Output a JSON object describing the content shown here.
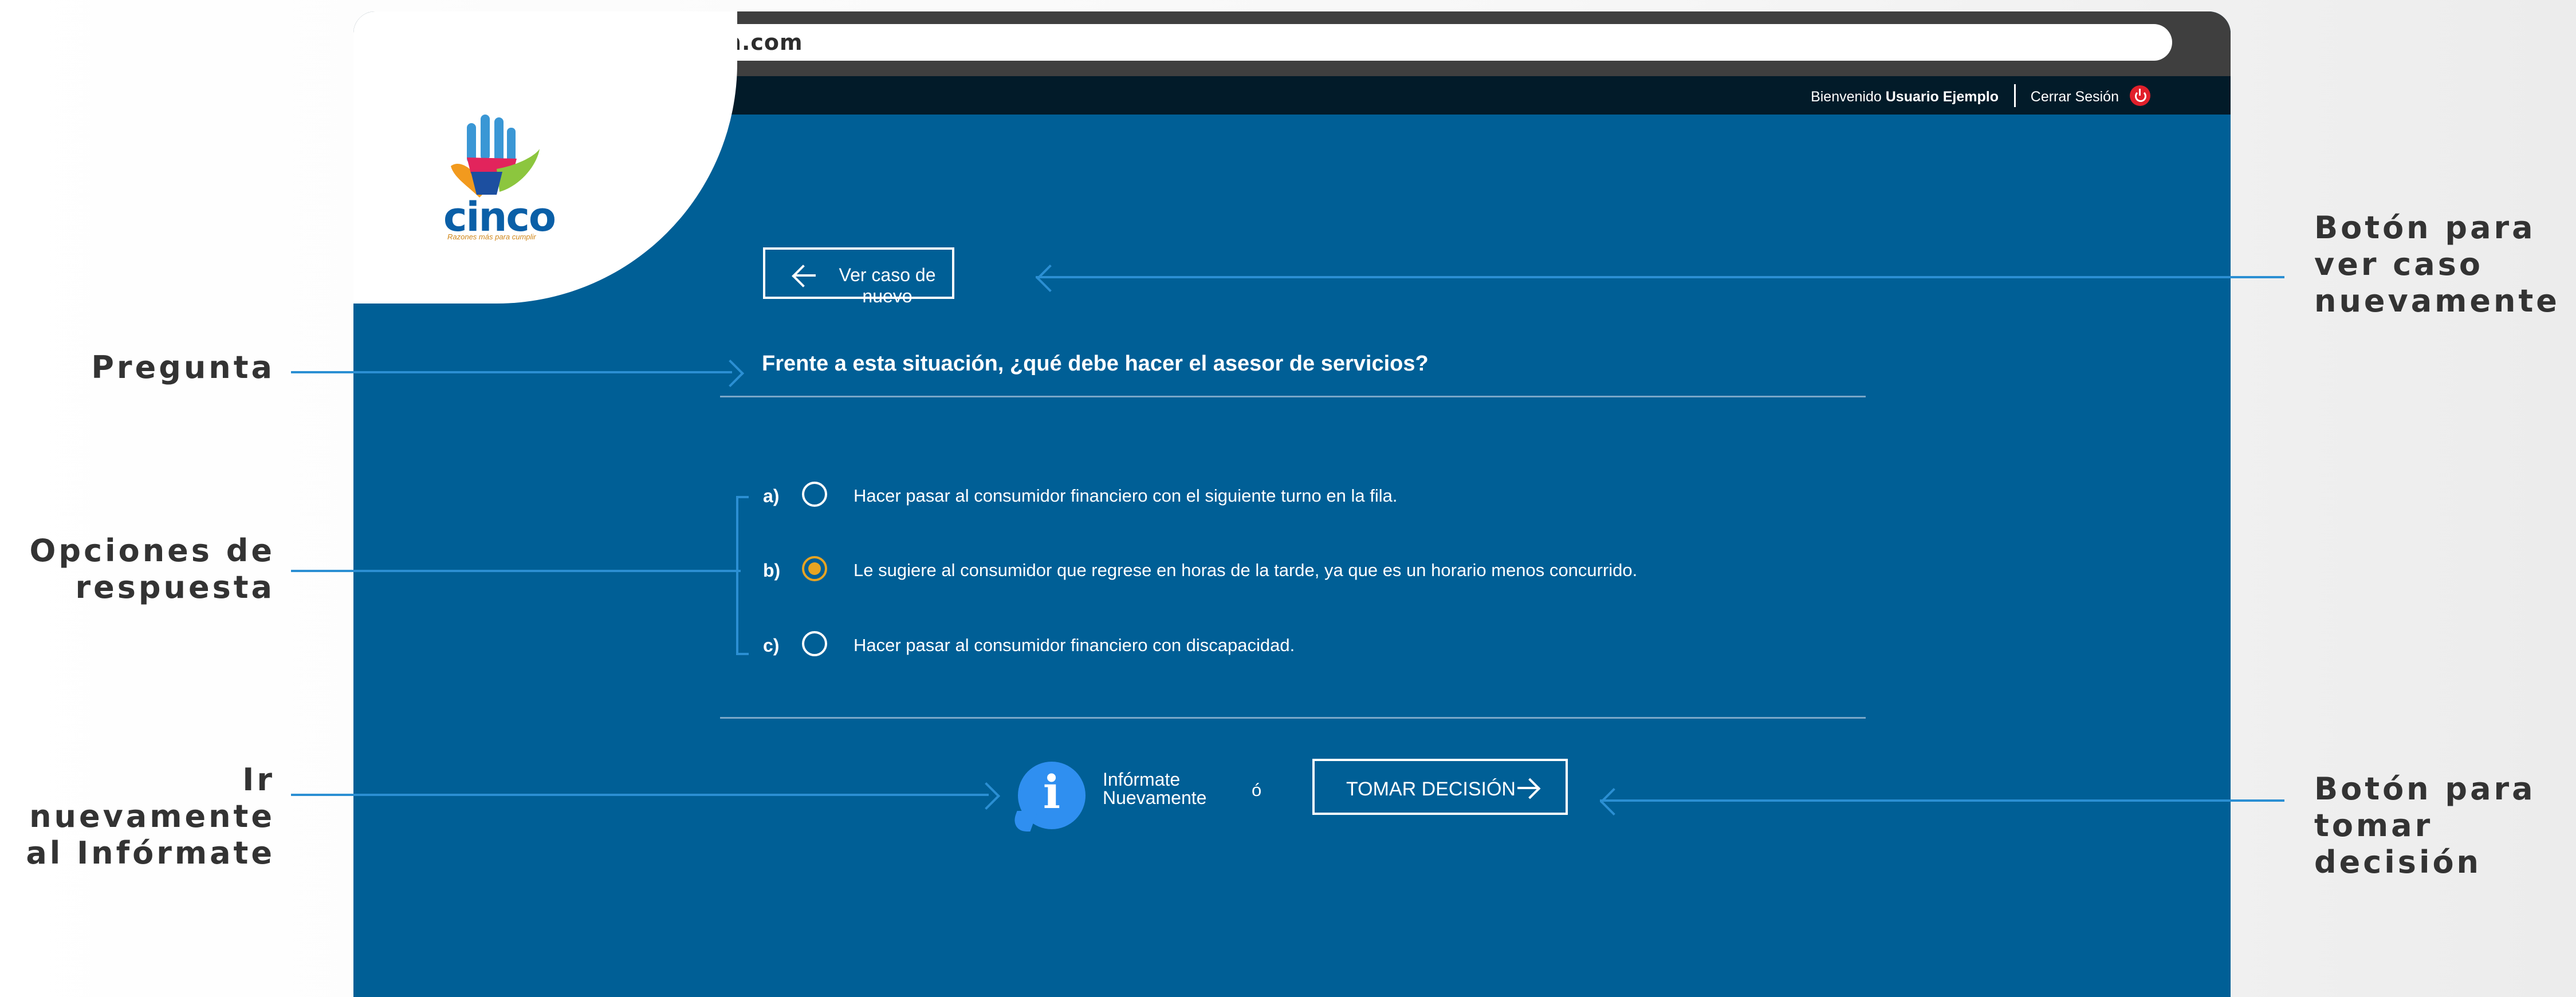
{
  "browser": {
    "url": "www.cincobmm.com",
    "traffic_lights": [
      "#ff5f7e",
      "#ffbd2e",
      "#28c840"
    ]
  },
  "topbar": {
    "welcome_prefix": "Bienvenido",
    "user_name": "Usuario Ejemplo",
    "logout_label": "Cerrar Sesión"
  },
  "logo": {
    "word": "cinco",
    "tagline": "Razones más para cumplir"
  },
  "main": {
    "back_button_label": "Ver caso de nuevo",
    "question": "Frente a esta situación, ¿qué debe hacer el asesor de servicios?",
    "options": [
      {
        "letter": "a)",
        "text": "Hacer pasar al consumidor financiero con el siguiente turno en la fila.",
        "selected": false
      },
      {
        "letter": "b)",
        "text": "Le sugiere al consumidor que regrese en horas de la tarde, ya que es un horario menos concurrido.",
        "selected": true
      },
      {
        "letter": "c)",
        "text": "Hacer pasar al consumidor financiero con discapacidad.",
        "selected": false
      }
    ],
    "info_line1": "Infórmate",
    "info_line2": "Nuevamente",
    "or_text": "ó",
    "decide_button_label": "TOMAR DECISIÓN"
  },
  "annotations": {
    "pregunta": "Pregunta",
    "opciones_1": "Opciones de",
    "opciones_2": "respuesta",
    "informate_1": "Ir nuevamente",
    "informate_2": "al Infórmate",
    "ver_caso_1": "Botón para",
    "ver_caso_2": "ver caso",
    "ver_caso_3": "nuevamente",
    "decision_1": "Botón para",
    "decision_2": "tomar decisión"
  },
  "colors": {
    "primary_blue": "#005f96",
    "topbar": "#021b29",
    "accent_orange": "#e7a422",
    "annotation_line": "#2b8fd3",
    "logout_red": "#e1202b"
  }
}
